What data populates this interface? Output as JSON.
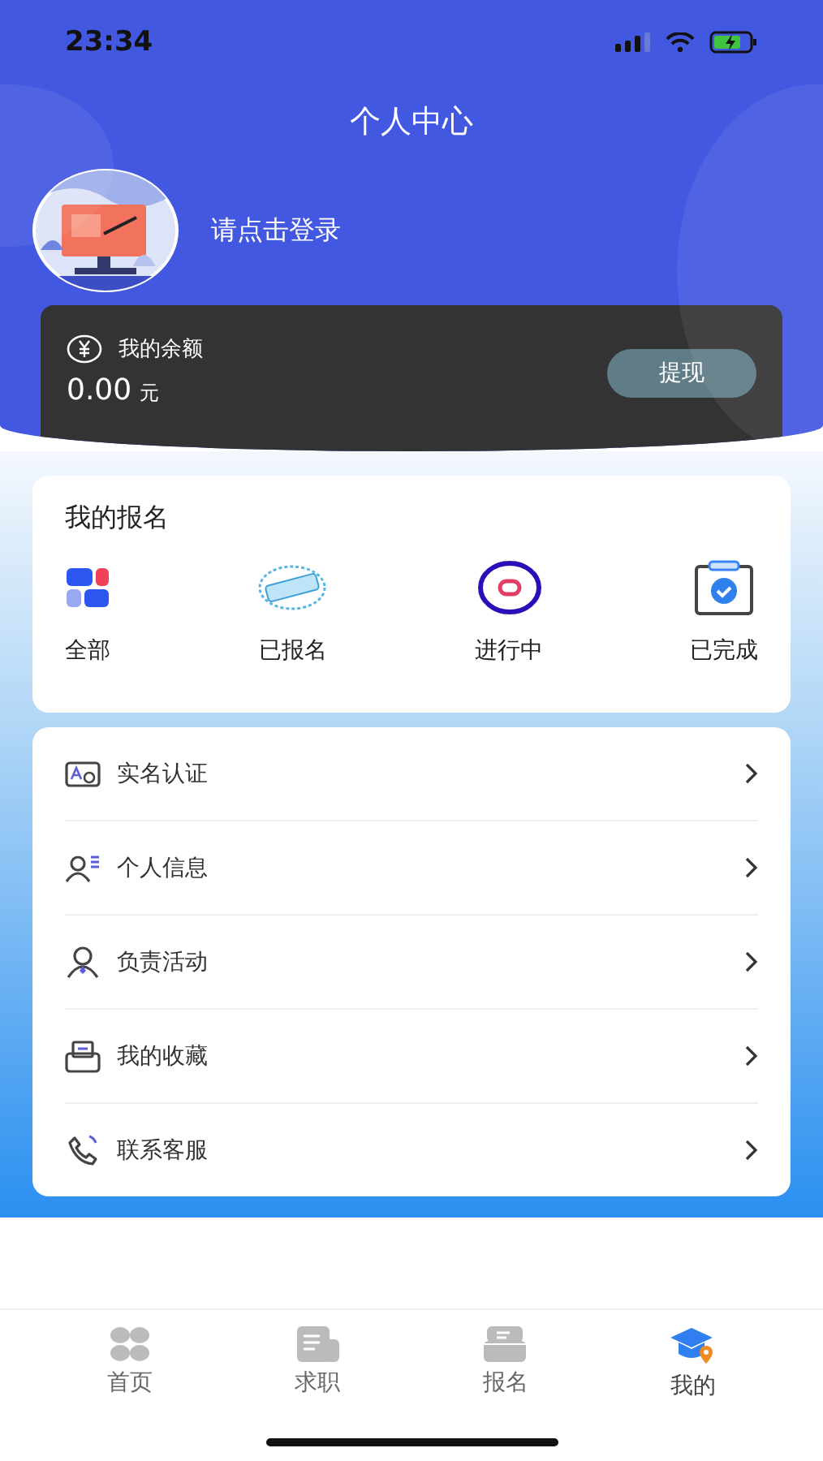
{
  "status_bar": {
    "time": "23:34"
  },
  "header": {
    "title": "个人中心",
    "login_prompt": "请点击登录"
  },
  "balance": {
    "label": "我的余额",
    "amount": "0.00",
    "unit": "元",
    "withdraw_button": "提现"
  },
  "signup": {
    "title": "我的报名",
    "items": [
      {
        "label": "全部"
      },
      {
        "label": "已报名"
      },
      {
        "label": "进行中"
      },
      {
        "label": "已完成"
      }
    ]
  },
  "menu": [
    {
      "label": "实名认证"
    },
    {
      "label": "个人信息"
    },
    {
      "label": "负责活动"
    },
    {
      "label": "我的收藏"
    },
    {
      "label": "联系客服"
    }
  ],
  "tab_bar": [
    {
      "label": "首页",
      "selected": false
    },
    {
      "label": "求职",
      "selected": false
    },
    {
      "label": "报名",
      "selected": false
    },
    {
      "label": "我的",
      "selected": true
    }
  ]
}
